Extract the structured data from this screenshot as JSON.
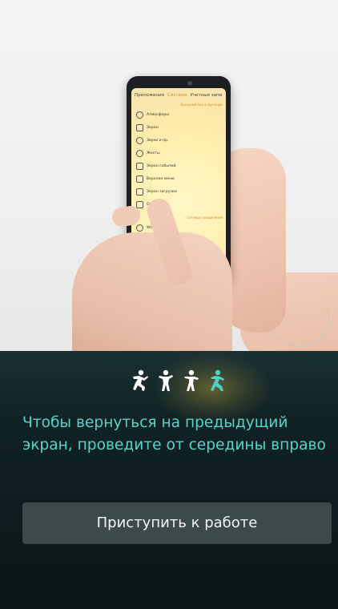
{
  "phone_screen": {
    "tabs": [
      {
        "label": "Приложения",
        "active": false
      },
      {
        "label": "Система",
        "active": true
      },
      {
        "label": "Учетные запи",
        "active": false
      }
    ],
    "section_title": "Внешний вид и функции",
    "items": [
      {
        "label": "Атмосферы",
        "icon": "palette-icon"
      },
      {
        "label": "Экран",
        "icon": "display-icon"
      },
      {
        "label": "Звуки и пр.",
        "icon": "sound-icon"
      },
      {
        "label": "Жесты",
        "icon": "gesture-icon"
      },
      {
        "label": "Экран событий",
        "icon": "events-icon"
      },
      {
        "label": "Верхнее меню",
        "icon": "menu-icon"
      },
      {
        "label": "Экран загрузки",
        "icon": "lock-icon"
      },
      {
        "label": "Обуч",
        "icon": "book-icon"
      }
    ],
    "section2_title": "Сетевые соединения",
    "items2": [
      {
        "label": "WLAN",
        "icon": "wifi-icon"
      },
      {
        "label": "Мобиль",
        "icon": "mobile-icon"
      }
    ]
  },
  "gesture_figures": {
    "count": 4,
    "active_index": 3,
    "active_color": "#4fd1c5",
    "inactive_color": "#ffffff"
  },
  "hint_text": "Чтобы вернуться на предыдущий экран, проведите от середины вправо",
  "start_button_label": "Приступить к работе",
  "colors": {
    "hint": "#53d6c6",
    "button_bg": "#3c4a4c",
    "accent": "#e08a1e"
  }
}
